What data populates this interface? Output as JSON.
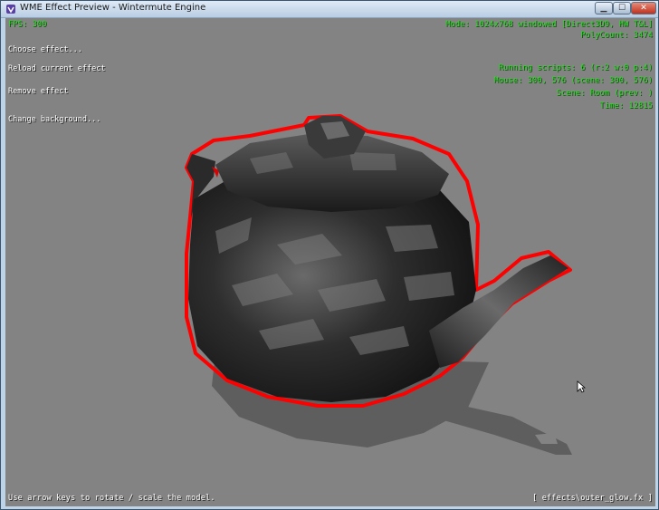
{
  "window": {
    "title": "WME Effect Preview - Wintermute Engine",
    "buttons": {
      "minimize": "▁",
      "maximize": "☐",
      "close": "✕"
    }
  },
  "hud": {
    "fps": "FPS: 300",
    "mode": "Mode: 1024x768 windowed [Direct3D9, HW T&L]",
    "polycount": "PolyCount: 3474",
    "running_scripts": "Running scripts: 6 (r:2 w:0 p:4)",
    "mouse": "Mouse: 300, 576 (scene: 300, 576)",
    "scene": "Scene: Room (prev: )",
    "time": "Time: 12815"
  },
  "menu": {
    "choose_effect": "Choose effect...",
    "reload_effect": "Reload current effect",
    "remove_effect": "Remove effect",
    "change_background": "Change background..."
  },
  "footer": {
    "hint": "Use arrow keys to rotate / scale the model.",
    "effect_path": "[ effects\\outer_glow.fx ]"
  },
  "colors": {
    "hud_green": "#25e01f",
    "background": "#838383",
    "outline": "#ff0000"
  }
}
